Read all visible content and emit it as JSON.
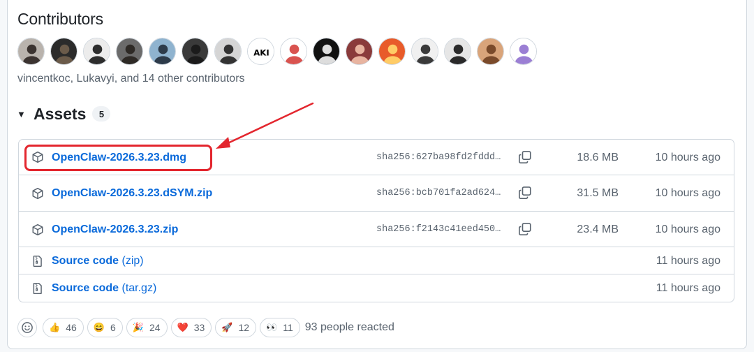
{
  "contributors": {
    "title": "Contributors",
    "summary": "vincentkoc, Lukavyi, and 14 other contributors",
    "avatars": [
      {
        "name": "avatar-1",
        "bg": "#b9b3ad",
        "fg": "#3b3330"
      },
      {
        "name": "avatar-2",
        "bg": "#2b2b2b",
        "fg": "#6b5b4a"
      },
      {
        "name": "avatar-3",
        "bg": "#ececec",
        "fg": "#2d2d2d"
      },
      {
        "name": "avatar-4",
        "bg": "#6b6b6b",
        "fg": "#2e2a26"
      },
      {
        "name": "avatar-5",
        "bg": "#8fb3cf",
        "fg": "#2d3b4a"
      },
      {
        "name": "avatar-6",
        "bg": "#3a3a3a",
        "fg": "#1b1b1b"
      },
      {
        "name": "avatar-7",
        "bg": "#d5d5d5",
        "fg": "#333333"
      },
      {
        "name": "avatar-8",
        "bg": "#ffffff",
        "fg": "#000000",
        "text": "AKI"
      },
      {
        "name": "avatar-9",
        "bg": "#ffffff",
        "fg": "#d9534f"
      },
      {
        "name": "avatar-10",
        "bg": "#111111",
        "fg": "#dddddd"
      },
      {
        "name": "avatar-11",
        "bg": "#8a3b3b",
        "fg": "#e8b4a0"
      },
      {
        "name": "avatar-12",
        "bg": "#e85b2a",
        "fg": "#ffcc66"
      },
      {
        "name": "avatar-13",
        "bg": "#f0f0f0",
        "fg": "#3a3a3a"
      },
      {
        "name": "avatar-14",
        "bg": "#e6e6e6",
        "fg": "#2a2a2a"
      },
      {
        "name": "avatar-15",
        "bg": "#d9a47a",
        "fg": "#7a4a2a"
      },
      {
        "name": "avatar-16",
        "bg": "#ffffff",
        "fg": "#9b7fd4"
      }
    ]
  },
  "assets": {
    "title": "Assets",
    "count": "5",
    "rows": [
      {
        "name": "OpenClaw-2026.3.23.dmg",
        "suffix": "",
        "sha": "sha256:627ba98fd2fddd…",
        "size": "18.6 MB",
        "time": "10 hours ago",
        "icon": "package-icon"
      },
      {
        "name": "OpenClaw-2026.3.23.dSYM.zip",
        "suffix": "",
        "sha": "sha256:bcb701fa2ad624…",
        "size": "31.5 MB",
        "time": "10 hours ago",
        "icon": "package-icon"
      },
      {
        "name": "OpenClaw-2026.3.23.zip",
        "suffix": "",
        "sha": "sha256:f2143c41eed450…",
        "size": "23.4 MB",
        "time": "10 hours ago",
        "icon": "package-icon"
      },
      {
        "name": "Source code",
        "suffix": "(zip)",
        "sha": "",
        "size": "",
        "time": "11 hours ago",
        "icon": "file-zip-icon"
      },
      {
        "name": "Source code",
        "suffix": "(tar.gz)",
        "sha": "",
        "size": "",
        "time": "11 hours ago",
        "icon": "file-zip-icon"
      }
    ]
  },
  "reactions": {
    "items": [
      {
        "emoji": "👍",
        "count": "46",
        "icon": "thumbs-up-icon"
      },
      {
        "emoji": "😄",
        "count": "6",
        "icon": "laugh-icon"
      },
      {
        "emoji": "🎉",
        "count": "24",
        "icon": "hooray-icon"
      },
      {
        "emoji": "❤️",
        "count": "33",
        "icon": "heart-icon"
      },
      {
        "emoji": "🚀",
        "count": "12",
        "icon": "rocket-icon"
      },
      {
        "emoji": "👀",
        "count": "11",
        "icon": "eyes-icon"
      }
    ],
    "summary": "93 people reacted"
  },
  "colors": {
    "link": "#0969da",
    "muted": "#59636e",
    "border": "#d0d7de",
    "annotation": "#e3262e"
  }
}
